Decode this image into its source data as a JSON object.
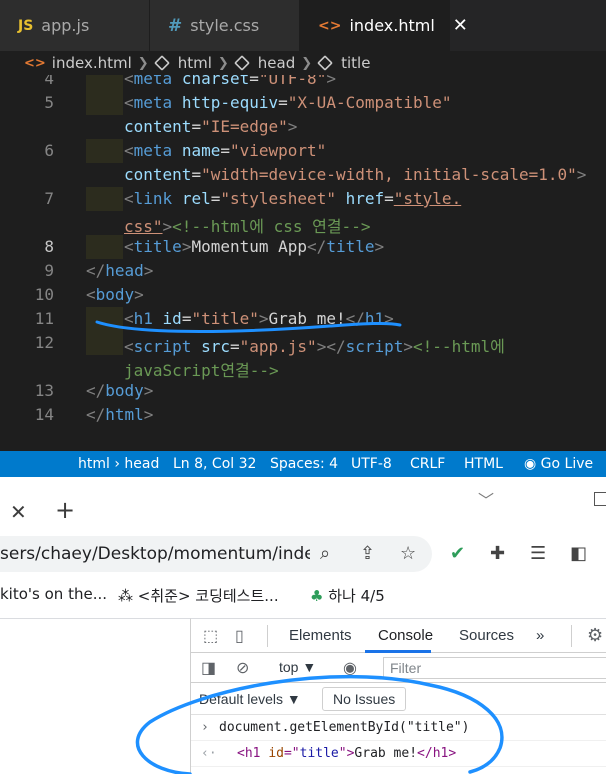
{
  "editor": {
    "tabs": [
      {
        "icon": "JS",
        "label": "app.js"
      },
      {
        "icon": "#",
        "label": "style.css"
      },
      {
        "icon": "<>",
        "label": "index.html",
        "close": "✕"
      }
    ],
    "breadcrumb": [
      "index.html",
      "html",
      "head",
      "title"
    ],
    "line_numbers": [
      "4",
      "5",
      "6",
      "7",
      "8",
      "9",
      "10",
      "11",
      "12",
      "13",
      "14"
    ],
    "status": {
      "path": "html › head",
      "position": "Ln 8, Col 32",
      "spaces": "Spaces: 4",
      "encoding": "UTF-8",
      "eol": "CRLF",
      "language": "HTML",
      "golive": "Go Live"
    }
  },
  "browser": {
    "url": "sers/chaey/Desktop/momentum/inde...",
    "bookmarks": [
      "kito's on the...",
      "<취준> 코딩테스트...",
      "하나 4/5"
    ]
  },
  "devtools": {
    "tabs": [
      "Elements",
      "Console",
      "Sources",
      "»"
    ],
    "context": "top ▼",
    "filter_placeholder": "Filter",
    "levels": "Default levels ▼",
    "issues": "No Issues",
    "input": "document.getElementById(\"title\")",
    "output_tag_open": "<h1 ",
    "output_attr": "id",
    "output_eq": "=\"",
    "output_val": "title",
    "output_close": "\">",
    "output_text": "Grab me!",
    "output_end": "</h1>"
  },
  "colors": {
    "statusbar": "#007acc",
    "annotation": "#1e90ff"
  }
}
